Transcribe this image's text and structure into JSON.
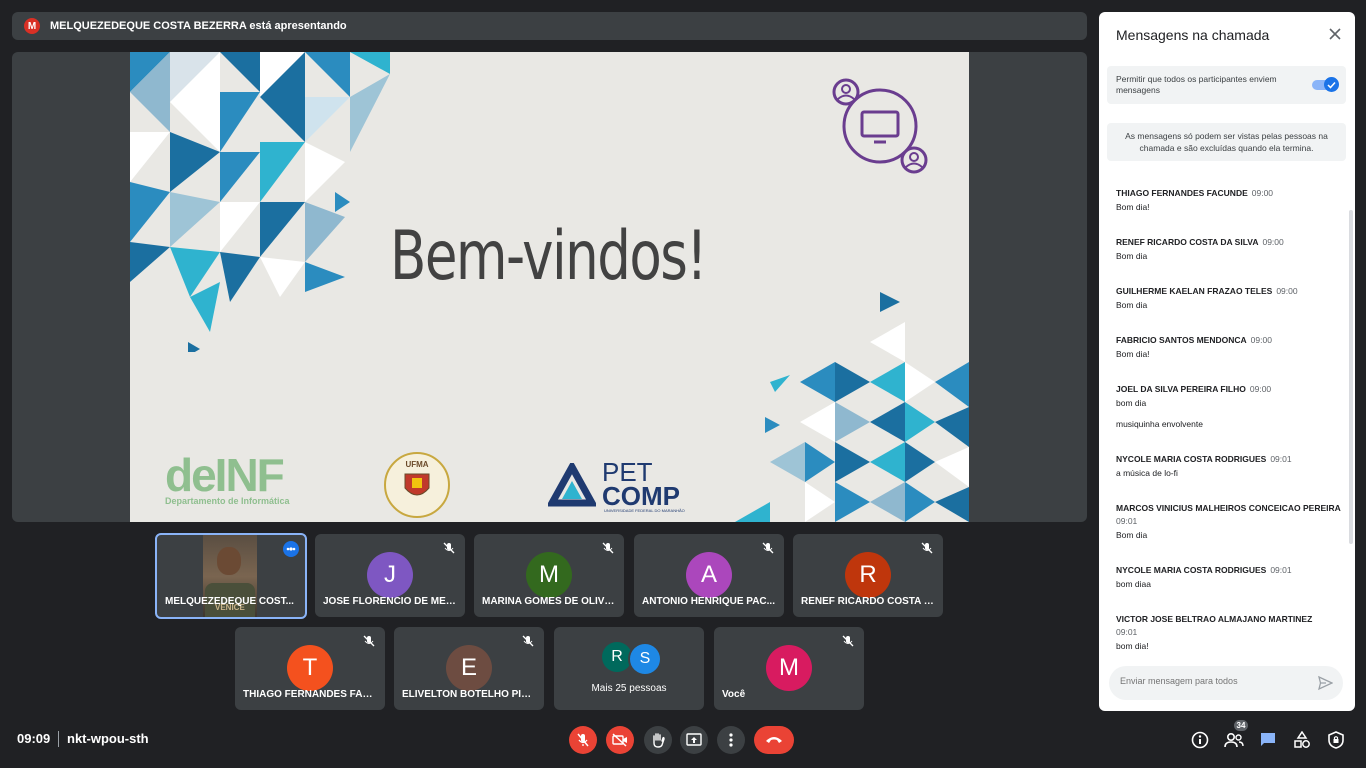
{
  "presenter": {
    "avatar_letter": "M",
    "banner_text": "MELQUEZEDEQUE COSTA BEZERRA está apresentando"
  },
  "slide": {
    "title": "Bem-vindos!",
    "deinf_word": "deINF",
    "deinf_sub": "Departamento de Informática",
    "ufma_text": "UFMA",
    "pet_word": "PET",
    "comp_word": "COMP",
    "petcomp_sub": "UNIVERSIDADE FEDERAL DO MARANHÃO"
  },
  "tiles": [
    {
      "name": "MELQUEZEDEQUE COST...",
      "initial": "",
      "color": "",
      "video": true,
      "watermark": "VENICE"
    },
    {
      "name": "JOSE FLORENCIO DE MEL...",
      "initial": "J",
      "color": "#7e57c2"
    },
    {
      "name": "MARINA GOMES DE OLIVE...",
      "initial": "M",
      "color": "#33691e"
    },
    {
      "name": "ANTONIO HENRIQUE PAC...",
      "initial": "A",
      "color": "#ab47bc"
    },
    {
      "name": "RENEF RICARDO COSTA D...",
      "initial": "R",
      "color": "#bf360c"
    },
    {
      "name": "THIAGO FERNANDES FAC...",
      "initial": "T",
      "color": "#f4511e"
    },
    {
      "name": "ELIVELTON BOTELHO PIN...",
      "initial": "E",
      "color": "#6d4c41"
    },
    {
      "name": "Mais 25 pessoas",
      "initials": [
        "R",
        "S"
      ],
      "colors": [
        "#00695c",
        "#1e88e5"
      ]
    },
    {
      "name": "Você",
      "initial": "M",
      "color": "#d81b60"
    }
  ],
  "bottom": {
    "time": "09:09",
    "meeting_code": "nkt-wpou-sth",
    "people_count": "34"
  },
  "chat": {
    "title": "Mensagens na chamada",
    "permission_text": "Permitir que todos os participantes enviem mensagens",
    "permission_enabled": true,
    "notice": "As mensagens só podem ser vistas pelas pessoas na chamada e são excluídas quando ela termina.",
    "input_placeholder": "Enviar mensagem para todos",
    "messages": [
      {
        "sender": "THIAGO FERNANDES FACUNDE",
        "time": "09:00",
        "text": "Bom dia!"
      },
      {
        "sender": "RENEF RICARDO COSTA DA SILVA",
        "time": "09:00",
        "text": "Bom dia"
      },
      {
        "sender": "GUILHERME KAELAN FRAZAO TELES",
        "time": "09:00",
        "text": "Bom dia"
      },
      {
        "sender": "FABRICIO SANTOS MENDONCA",
        "time": "09:00",
        "text": "Bom dia!"
      },
      {
        "sender": "JOEL DA SILVA PEREIRA FILHO",
        "time": "09:00",
        "text": "bom dia",
        "extra": "musiquinha envolvente"
      },
      {
        "sender": "NYCOLE MARIA COSTA RODRIGUES",
        "time": "09:01",
        "text": "a música de lo-fi"
      },
      {
        "sender": "MARCOS VINICIUS MALHEIROS CONCEICAO PEREIRA",
        "time": "09:01",
        "text": "Bom dia",
        "time_below": true
      },
      {
        "sender": "NYCOLE MARIA COSTA RODRIGUES",
        "time": "09:01",
        "text": "bom diaa"
      },
      {
        "sender": "VICTOR JOSE BELTRAO ALMAJANO MARTINEZ",
        "time": "09:01",
        "text": "bom dia!",
        "time_below": true
      }
    ]
  },
  "colors": {
    "background": "#202124",
    "surface": "#3c4043",
    "danger": "#ea4335",
    "accent": "#1a73e8",
    "slide_blue": "#1b6fa0",
    "slide_cyan": "#2fb3cf"
  }
}
